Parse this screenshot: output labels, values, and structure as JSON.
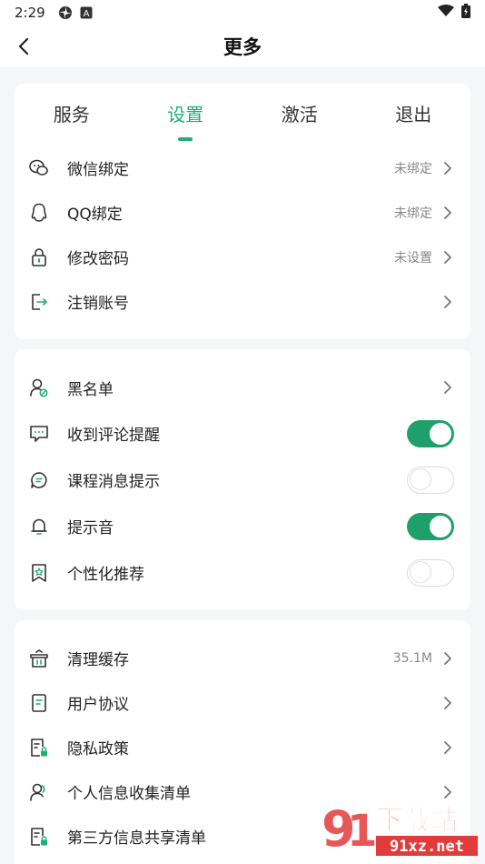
{
  "status_bar": {
    "time": "2:29"
  },
  "header": {
    "title": "更多"
  },
  "tabs": [
    {
      "label": "服务",
      "active": false
    },
    {
      "label": "设置",
      "active": true
    },
    {
      "label": "激活",
      "active": false
    },
    {
      "label": "退出",
      "active": false
    }
  ],
  "account_section": [
    {
      "label": "微信绑定",
      "value": "未绑定",
      "icon": "wechat-icon"
    },
    {
      "label": "QQ绑定",
      "value": "未绑定",
      "icon": "qq-icon"
    },
    {
      "label": "修改密码",
      "value": "未设置",
      "icon": "lock-icon"
    },
    {
      "label": "注销账号",
      "value": "",
      "icon": "logout-icon"
    }
  ],
  "preference_section": [
    {
      "label": "黑名单",
      "type": "link",
      "icon": "blacklist-icon"
    },
    {
      "label": "收到评论提醒",
      "type": "toggle",
      "on": true,
      "icon": "comment-icon"
    },
    {
      "label": "课程消息提示",
      "type": "toggle",
      "on": false,
      "icon": "message-icon"
    },
    {
      "label": "提示音",
      "type": "toggle",
      "on": true,
      "icon": "bell-icon"
    },
    {
      "label": "个性化推荐",
      "type": "toggle",
      "on": false,
      "icon": "bookmark-star-icon"
    }
  ],
  "misc_section": [
    {
      "label": "清理缓存",
      "value": "35.1M",
      "icon": "clean-icon"
    },
    {
      "label": "用户协议",
      "value": "",
      "icon": "document-icon"
    },
    {
      "label": "隐私政策",
      "value": "",
      "icon": "privacy-doc-icon"
    },
    {
      "label": "个人信息收集清单",
      "value": "",
      "icon": "user-info-icon"
    },
    {
      "label": "第三方信息共享清单",
      "value": "",
      "icon": "share-doc-icon"
    }
  ],
  "watermark": {
    "text": "下载站",
    "url_text": "91xz.net"
  },
  "colors": {
    "accent": "#1fae74",
    "toggle_on": "#1fa06b",
    "background": "#f4f6f8"
  }
}
